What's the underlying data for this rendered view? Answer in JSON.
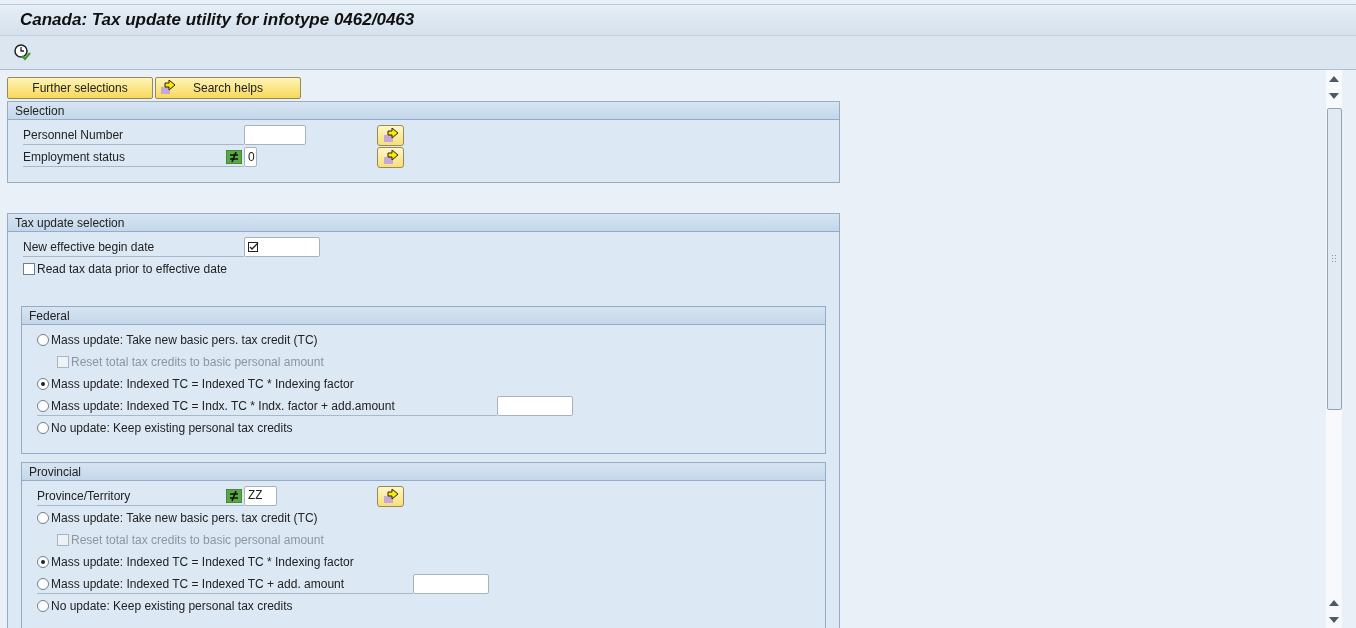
{
  "window": {
    "title": "Canada: Tax update utility for infotype 0462/0463"
  },
  "buttons": [
    {
      "label": "Further selections",
      "icon": false
    },
    {
      "label": "Search helps",
      "icon": true
    }
  ],
  "selection": {
    "title": "Selection",
    "rows": [
      {
        "label": "Personnel Number",
        "value": "",
        "excluding": false,
        "multiple": true
      },
      {
        "label": "Employment status",
        "value": "0",
        "excluding": true,
        "multiple": true
      }
    ]
  },
  "tax_update": {
    "title": "Tax update selection",
    "date_label": "New effective begin date",
    "date_required": true,
    "read_prior": {
      "label": "Read tax data prior to effective date",
      "checked": false
    },
    "federal": {
      "title": "Federal",
      "items": [
        {
          "kind": "radio",
          "label": "Mass update: Take new basic pers. tax credit (TC)",
          "selected": false
        },
        {
          "kind": "checkbox",
          "label": "Reset total tax credits to basic personal amount",
          "checked": false,
          "disabled": true
        },
        {
          "kind": "radio",
          "label": "Mass update: Indexed TC = Indexed TC * Indexing factor",
          "selected": true
        },
        {
          "kind": "radio-field",
          "label": "Mass update: Indexed TC = Indx. TC * Indx. factor + add.amount",
          "selected": false
        },
        {
          "kind": "radio",
          "label": "No update: Keep existing personal tax credits",
          "selected": false
        }
      ]
    },
    "provincial": {
      "title": "Provincial",
      "province": {
        "label": "Province/Territory",
        "value": "ZZ",
        "excluding": true,
        "multiple": true
      },
      "items": [
        {
          "kind": "radio",
          "label": "Mass update: Take new basic pers. tax credit (TC)",
          "selected": false
        },
        {
          "kind": "checkbox",
          "label": "Reset total tax credits to basic personal amount",
          "checked": false,
          "disabled": true
        },
        {
          "kind": "radio",
          "label": "Mass update: Indexed TC = Indexed TC * Indexing factor",
          "selected": true
        },
        {
          "kind": "radio-field",
          "label": "Mass update: Indexed TC = Indexed TC + add. amount",
          "selected": false
        },
        {
          "kind": "radio",
          "label": "No update: Keep existing personal tax credits",
          "selected": false
        }
      ]
    }
  }
}
